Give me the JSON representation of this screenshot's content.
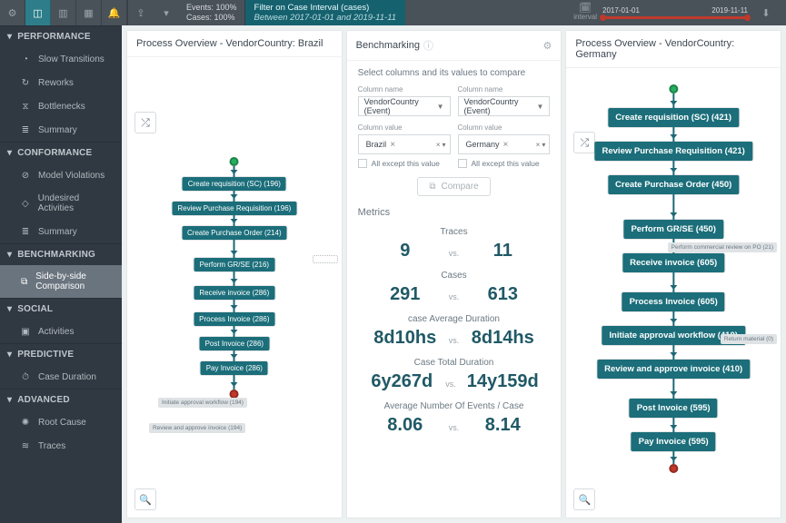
{
  "topbar": {
    "stats": {
      "events": "Events: 100%",
      "cases": "Cases: 100%"
    },
    "filter": {
      "title": "Filter on Case Interval (cases)",
      "subtitle": "Between 2017-01-01 and 2019-11-11"
    },
    "interval": {
      "icon_label": "interval",
      "start": "2017-01-01",
      "end": "2019-11-11"
    }
  },
  "sidebar": {
    "performance": {
      "header": "PERFORMANCE",
      "items": [
        "Slow Transitions",
        "Reworks",
        "Bottlenecks",
        "Summary"
      ]
    },
    "conformance": {
      "header": "CONFORMANCE",
      "items": [
        "Model Violations",
        "Undesired Activities",
        "Summary"
      ]
    },
    "benchmarking": {
      "header": "BENCHMARKING",
      "items": [
        "Side-by-side Comparison"
      ]
    },
    "social": {
      "header": "SOCIAL",
      "items": [
        "Activities"
      ]
    },
    "predictive": {
      "header": "PREDICTIVE",
      "items": [
        "Case Duration"
      ]
    },
    "advanced": {
      "header": "ADVANCED",
      "items": [
        "Root Cause",
        "Traces"
      ]
    }
  },
  "left_panel": {
    "title": "Process Overview - VendorCountry: Brazil",
    "nodes": [
      "Create requisition (SC) (196)",
      "Review Purchase Requisition (196)",
      "Create Purchase Order (214)",
      "Perform GR/SE (216)",
      "Receive invoice (286)",
      "Process Invoice (286)",
      "Post Invoice (286)",
      "Pay Invoice (286)",
      "Initiate approval workflow (194)",
      "Review and approve invoice (194)"
    ]
  },
  "right_panel": {
    "title": "Process Overview - VendorCountry: Germany",
    "nodes": [
      "Create requisition (SC) (421)",
      "Review Purchase Requisition (421)",
      "Create Purchase Order (450)",
      "Perform GR/SE (450)",
      "Receive invoice (605)",
      "Process Invoice (605)",
      "Initiate approval workflow (410)",
      "Review and approve invoice (410)",
      "Post Invoice (595)",
      "Pay Invoice (595)"
    ],
    "side_nodes": [
      "Perform commercial review on PO (21)",
      "Return material (0)"
    ]
  },
  "benchmarking_panel": {
    "title": "Benchmarking",
    "subtitle": "Select columns and its values to compare",
    "col_name_label": "Column name",
    "col_value_label": "Column value",
    "col_name_value": "VendorCountry (Event)",
    "left_value": "Brazil",
    "right_value": "Germany",
    "except_label": "All except this value",
    "compare_label": "Compare",
    "metrics_header": "Metrics",
    "metrics": [
      {
        "label": "Traces",
        "left": "9",
        "right": "11"
      },
      {
        "label": "Cases",
        "left": "291",
        "right": "613"
      },
      {
        "label": "case Average Duration",
        "left": "8d10hs",
        "right": "8d14hs"
      },
      {
        "label": "Case Total Duration",
        "left": "6y267d",
        "right": "14y159d"
      },
      {
        "label": "Average Number Of Events / Case",
        "left": "8.06",
        "right": "8.14"
      }
    ],
    "vs": "vs."
  }
}
